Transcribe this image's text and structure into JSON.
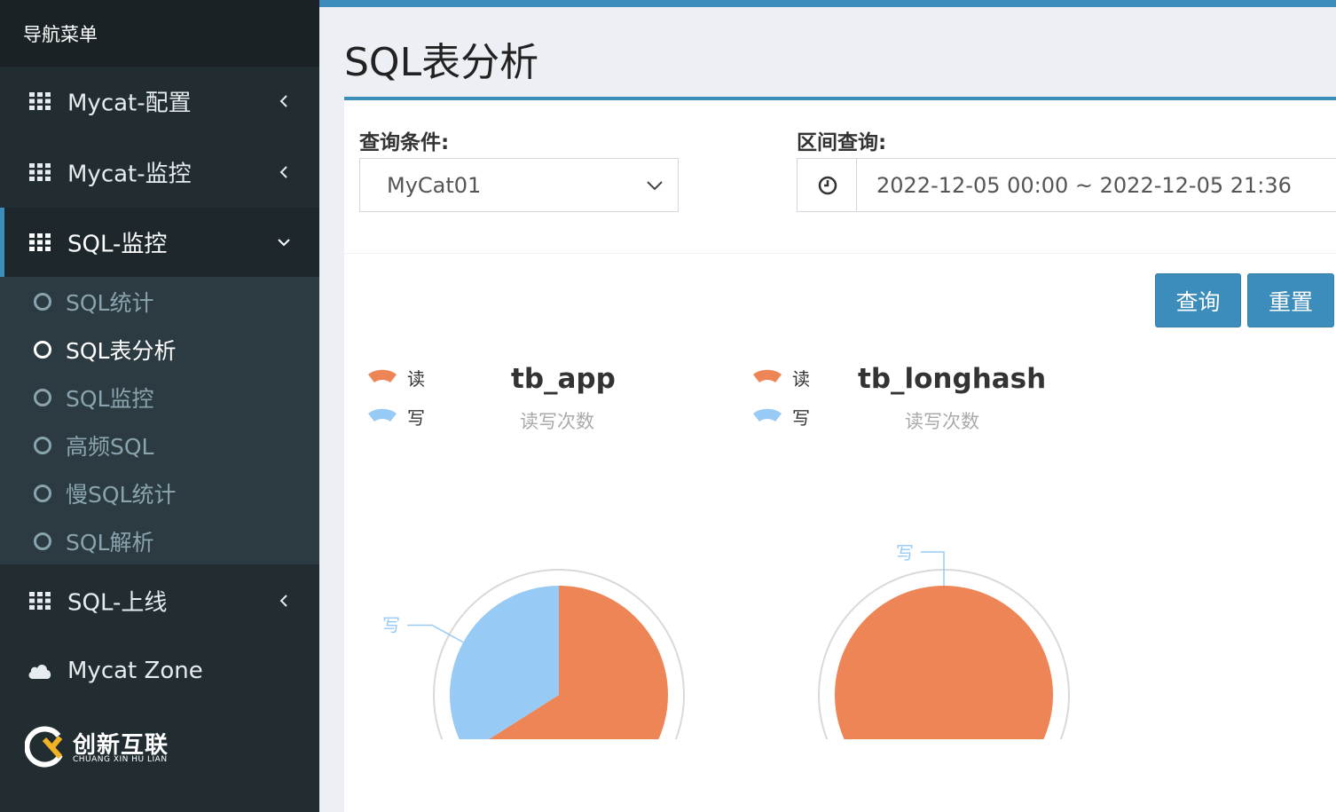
{
  "sidebar": {
    "header": "导航菜单",
    "menu": [
      {
        "label": "Mycat-配置"
      },
      {
        "label": "Mycat-监控"
      },
      {
        "label": "SQL-监控"
      },
      {
        "label": "SQL-上线"
      },
      {
        "label": "Mycat Zone"
      }
    ],
    "submenu": [
      {
        "label": "SQL统计"
      },
      {
        "label": "SQL表分析"
      },
      {
        "label": "SQL监控"
      },
      {
        "label": "高频SQL"
      },
      {
        "label": "慢SQL统计"
      },
      {
        "label": "SQL解析"
      }
    ],
    "logo": {
      "text": "创新互联",
      "sub": "CHUANG XIN HU LIAN"
    }
  },
  "page": {
    "title": "SQL表分析"
  },
  "filters": {
    "condition_label": "查询条件:",
    "condition_value": "MyCat01",
    "range_label": "区间查询:",
    "range_value": "2022-12-05 00:00 ~ 2022-12-05 21:36"
  },
  "buttons": {
    "query": "查询",
    "reset": "重置"
  },
  "colors": {
    "read": "#ed8557",
    "write": "#97cbf5",
    "accent": "#3c8dbc"
  },
  "chart_data": [
    {
      "type": "pie",
      "title": "tb_app",
      "subtitle": "读写次数",
      "legend": [
        "读",
        "写"
      ],
      "series": [
        {
          "name": "读",
          "value": 66
        },
        {
          "name": "写",
          "value": 34
        }
      ]
    },
    {
      "type": "pie",
      "title": "tb_longhash",
      "subtitle": "读写次数",
      "legend": [
        "读",
        "写"
      ],
      "series": [
        {
          "name": "读",
          "value": 100
        },
        {
          "name": "写",
          "value": 0
        }
      ]
    }
  ]
}
